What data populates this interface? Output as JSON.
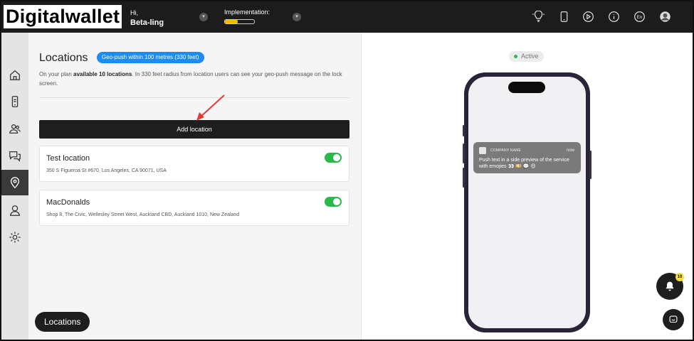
{
  "app": {
    "logo": "Digitalwallet"
  },
  "header": {
    "greeting": "Hi,",
    "user": "Beta-ling",
    "implementation_label": "Implementation:",
    "implementation_progress": 0.45,
    "language": "En",
    "icons": [
      "lightbulb-icon",
      "phone-icon",
      "play-icon",
      "info-icon",
      "language-icon",
      "avatar"
    ]
  },
  "sidebar": {
    "items": [
      {
        "name": "home",
        "icon": "home-icon"
      },
      {
        "name": "device",
        "icon": "device-icon"
      },
      {
        "name": "users",
        "icon": "users-icon"
      },
      {
        "name": "messages",
        "icon": "chat-icon"
      },
      {
        "name": "locations",
        "icon": "location-pin-icon",
        "active": true
      },
      {
        "name": "profile",
        "icon": "profile-icon"
      },
      {
        "name": "settings",
        "icon": "gear-icon"
      }
    ]
  },
  "main": {
    "title": "Locations",
    "geo_badge": "Geo-push within 100 metres (330 feet)",
    "desc_prefix": "On your plan ",
    "desc_bold": "available 10 locations",
    "desc_suffix": ". In 330 feet radius from location users can see your geo-push message on the lock screen.",
    "add_button": "Add location",
    "locations": [
      {
        "name": "Test location",
        "address": "350 S Figueroa St #670, Los Angeles, CA 90071, USA",
        "enabled": true
      },
      {
        "name": "MacDonalds",
        "address": "Shop 8, The Civic, Wellesley Street West, Auckland CBD, Auckland 1010, New Zealand",
        "enabled": true
      }
    ],
    "footer_pill": "Locations"
  },
  "preview": {
    "status": "Active",
    "notification": {
      "company": "COMPANY NAME",
      "time": "now",
      "message": "Push text in a side preview of the service with emojies 👀 💴 💬 😍"
    },
    "notification_count": "10"
  },
  "colors": {
    "topbar": "#1c1c1c",
    "accent_blue": "#1d8cf0",
    "toggle_green": "#2ab84a",
    "progress_yellow": "#f5b800",
    "arrow_red": "#e53935"
  }
}
